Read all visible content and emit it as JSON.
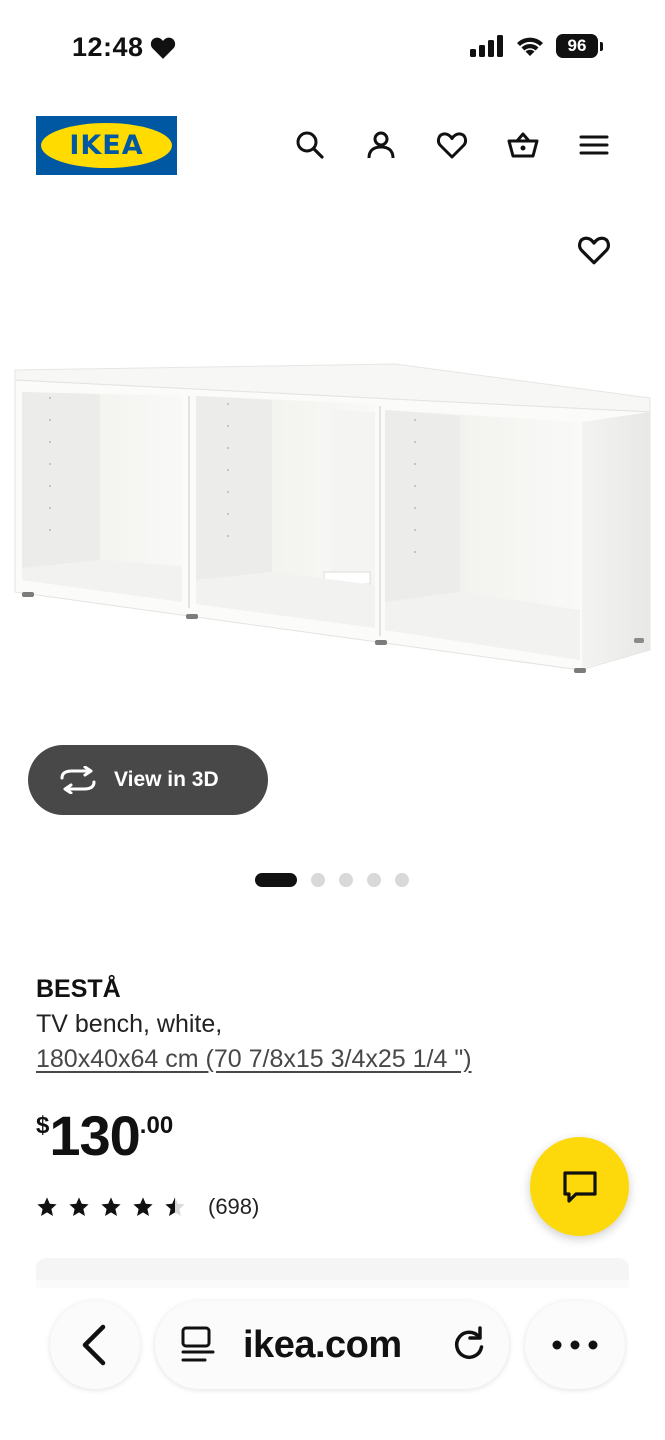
{
  "status_bar": {
    "time": "12:48",
    "battery": "96"
  },
  "header": {
    "logo_text": "IKEA",
    "icons": [
      "search-icon",
      "account-icon",
      "heart-icon",
      "basket-icon",
      "menu-icon"
    ]
  },
  "gallery": {
    "view3d_label": "View in 3D",
    "page_count": 5,
    "active_page": 1
  },
  "product": {
    "name": "BESTÅ",
    "description": "TV bench, white,",
    "size": "180x40x64 cm (70 7/8x15 3/4x25 1/4 \")",
    "price": {
      "currency": "$",
      "whole": "130",
      "decimal": ".00"
    },
    "rating": {
      "stars": 4.5,
      "out_of": 5,
      "count_label": "(698)"
    }
  },
  "browser": {
    "url": "ikea.com"
  },
  "colors": {
    "ikea_blue": "#0058a3",
    "ikea_yellow": "#ffdb00",
    "chat_yellow": "#fdd90b",
    "view3d_bg": "#484848"
  }
}
